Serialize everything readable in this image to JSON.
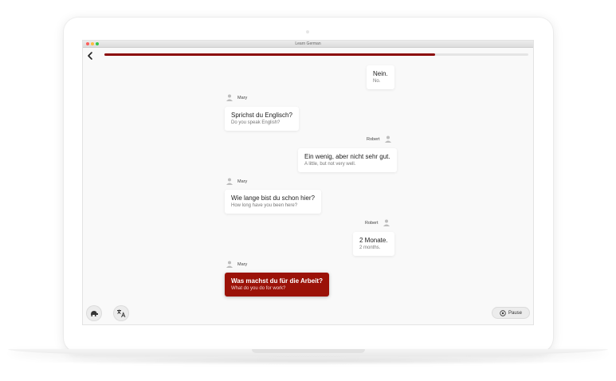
{
  "window": {
    "title": "Learn German"
  },
  "progress": {
    "value": 0.78,
    "color": "#8b0a0a"
  },
  "accent_color": "#9b1208",
  "messages": [
    {
      "speaker": "",
      "side": "right",
      "text": "Nein.",
      "translation": "No."
    },
    {
      "speaker": "Mary",
      "side": "left",
      "text": "Sprichst du Englisch?",
      "translation": "Do you speak English?"
    },
    {
      "speaker": "Robert",
      "side": "right",
      "text": "Ein wenig, aber nicht sehr gut.",
      "translation": "A little, but not very well."
    },
    {
      "speaker": "Mary",
      "side": "left",
      "text": "Wie lange bist du schon hier?",
      "translation": "How long have you been here?"
    },
    {
      "speaker": "Robert",
      "side": "right",
      "text": "2 Monate.",
      "translation": "2 months."
    },
    {
      "speaker": "Mary",
      "side": "left",
      "text": "Was machst du für die Arbeit?",
      "translation": "What do you do for work?",
      "active": true
    }
  ],
  "controls": {
    "speed_icon": "turtle-icon",
    "translate_icon": "translate-icon",
    "pause_label": "Pause",
    "pause_icon": "pause-circle-icon"
  }
}
